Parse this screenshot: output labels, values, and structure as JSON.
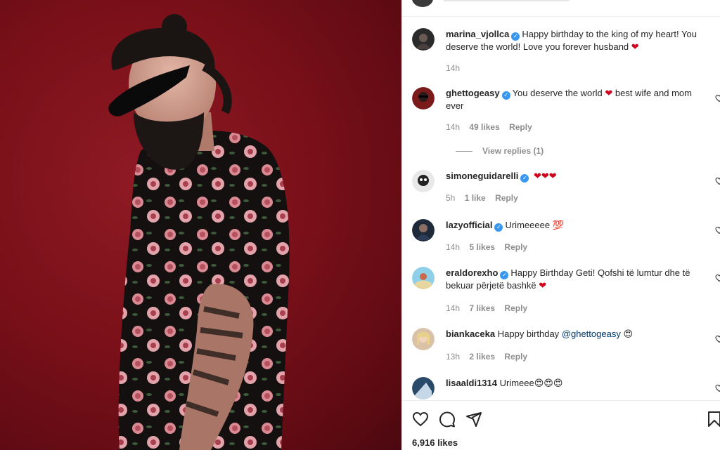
{
  "post": {
    "likes_text": "6,916 likes"
  },
  "comments": [
    {
      "username": "marina_vjollca",
      "verified": true,
      "text_parts": [
        "Happy birthday to the king of my heart! You deserve the world! Love you forever husband "
      ],
      "emoji_end": "❤",
      "time": "14h",
      "likes": "",
      "reply": ""
    },
    {
      "username": "ghettogeasy",
      "verified": true,
      "text_before": "You deserve the world ",
      "emoji_mid": "❤",
      "text_after": " best wife and mom ever",
      "time": "14h",
      "likes": "49 likes",
      "reply": "Reply",
      "view_replies": "View replies (1)"
    },
    {
      "username": "simoneguidarelli",
      "verified": true,
      "emojis": "❤❤❤",
      "time": "5h",
      "likes": "1 like",
      "reply": "Reply"
    },
    {
      "username": "lazyofficial",
      "verified": true,
      "text": "Urimeeeee ",
      "emoji_end": "💯",
      "time": "14h",
      "likes": "5 likes",
      "reply": "Reply"
    },
    {
      "username": "eraldorexho",
      "verified": true,
      "text": "Happy Birthday Geti! Qofshi të lumtur dhe të bekuar përjetë bashkë ",
      "emoji_end": "❤",
      "time": "14h",
      "likes": "7 likes",
      "reply": "Reply"
    },
    {
      "username": "biankaceka",
      "verified": false,
      "text": "Happy birthday ",
      "mention": "@ghettogeasy",
      "emoji_end": " 😍",
      "time": "13h",
      "likes": "2 likes",
      "reply": "Reply"
    },
    {
      "username": "lisaaldi1314",
      "verified": false,
      "text": "Urimeee",
      "emoji_end": "😍😍😍",
      "time": "",
      "likes": "",
      "reply": ""
    }
  ],
  "icons": {
    "like": "heart-outline-icon",
    "comment": "comment-bubble-icon",
    "share": "paper-plane-icon",
    "save": "bookmark-icon"
  },
  "colors": {
    "background_red": "#7a1019",
    "verified_blue": "#3897f0",
    "heart_red": "#d0021b",
    "meta_gray": "#8e8e8e",
    "mention_blue": "#00376b"
  }
}
